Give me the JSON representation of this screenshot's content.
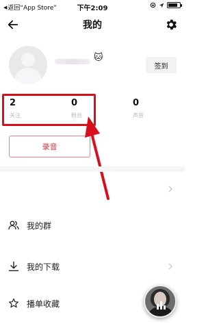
{
  "status_bar": {
    "back_label": "返回“App Store”",
    "time": "下午2:09",
    "signal_dots": "●●●●○",
    "battery_level": 0.85
  },
  "nav": {
    "title": "我的",
    "back_icon": "back-arrow-icon",
    "settings_icon": "gear-icon"
  },
  "profile": {
    "badge_icon": "cat-face-icon",
    "badge_glyph": "🐱",
    "checkin_label": "签到"
  },
  "stats": [
    {
      "count": "2",
      "label": "关注"
    },
    {
      "count": "0",
      "label": "粉丝"
    },
    {
      "count": "0",
      "label": "声音"
    }
  ],
  "record_button_label": "录音",
  "menu": [
    {
      "label": "我的群",
      "icon": "group-icon"
    },
    {
      "label": "我的下载",
      "icon": "download-icon"
    },
    {
      "label": "播单收藏",
      "icon": "star-icon"
    }
  ],
  "colors": {
    "accent_red": "#e02e3d",
    "annotation_red": "#d8101c",
    "muted_text": "#b9b9b9",
    "divider": "#f5f5f5"
  }
}
